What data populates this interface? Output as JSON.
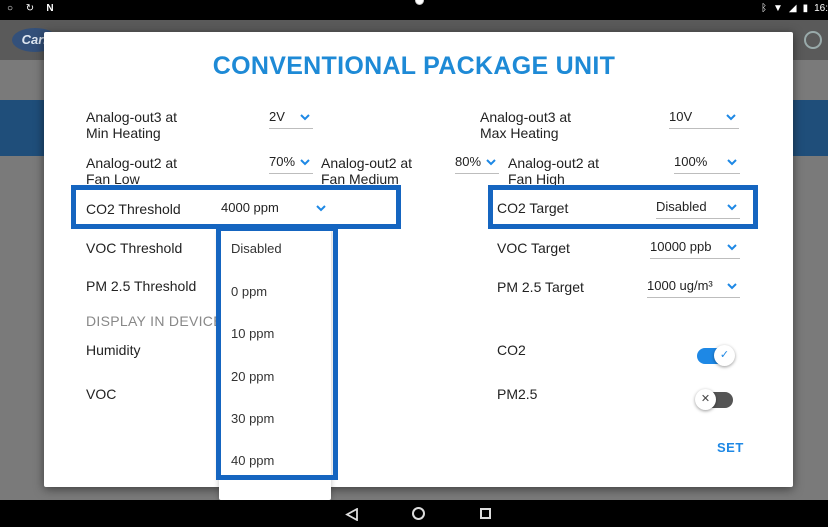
{
  "status_bar": {
    "left_icons": [
      "circle-notification-icon",
      "sync-icon",
      "n-notification-icon"
    ],
    "right_icons": [
      "bluetooth-icon",
      "wifi-icon",
      "signal-icon",
      "battery-icon"
    ],
    "time": "16:"
  },
  "background": {
    "logo_text": "Carr"
  },
  "dialog": {
    "title": "CONVENTIONAL PACKAGE UNIT",
    "rows": {
      "ao3_min_heating": {
        "label": "Analog-out3 at\nMin Heating",
        "value": "2V"
      },
      "ao3_max_heating": {
        "label": "Analog-out3 at\nMax Heating",
        "value": "10V"
      },
      "ao2_fan_low": {
        "label": "Analog-out2 at\nFan Low",
        "value": "70%"
      },
      "ao2_fan_medium": {
        "label": "Analog-out2 at\nFan Medium",
        "value": "80%"
      },
      "ao2_fan_high": {
        "label": "Analog-out2 at\nFan High",
        "value": "100%"
      },
      "co2_threshold": {
        "label": "CO2 Threshold",
        "value": "4000 ppm"
      },
      "co2_target": {
        "label": "CO2 Target",
        "value": "Disabled"
      },
      "voc_threshold": {
        "label": "VOC Threshold"
      },
      "voc_target": {
        "label": "VOC Target",
        "value": "10000 ppb"
      },
      "pm25_threshold": {
        "label": "PM 2.5 Threshold"
      },
      "pm25_target": {
        "label": "PM 2.5 Target",
        "value": "1000 ug/m³"
      }
    },
    "display_section": "DISPLAY IN DEVICE",
    "toggles": {
      "humidity": {
        "label": "Humidity"
      },
      "voc": {
        "label": "VOC"
      },
      "co2": {
        "label": "CO2",
        "on": true
      },
      "pm25": {
        "label": "PM2.5",
        "on": false
      }
    },
    "dropdown_options": [
      "Disabled",
      "0 ppm",
      "10 ppm",
      "20 ppm",
      "30 ppm",
      "40 ppm"
    ],
    "set_label": "SET"
  },
  "colors": {
    "accent": "#1e88e5",
    "title": "#1e8ad6",
    "highlight": "#1565c0"
  }
}
